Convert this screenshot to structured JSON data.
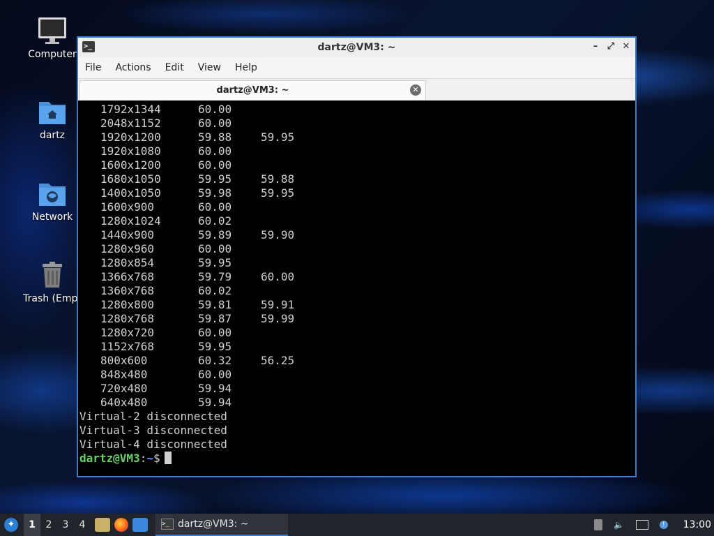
{
  "desktop": {
    "icons": [
      {
        "label": "Computer",
        "icon": "computer-icon"
      },
      {
        "label": "dartz",
        "icon": "home-folder-icon"
      },
      {
        "label": "Network",
        "icon": "network-folder-icon"
      },
      {
        "label": "Trash (Empt",
        "icon": "trash-icon"
      }
    ]
  },
  "window": {
    "title": "dartz@VM3: ~",
    "menu": [
      "File",
      "Actions",
      "Edit",
      "View",
      "Help"
    ],
    "tab_label": "dartz@VM3: ~",
    "controls": {
      "minimize": "–",
      "maximize": "⤢",
      "close": "✕"
    }
  },
  "terminal": {
    "modes": [
      [
        "1792x1344",
        "60.00",
        ""
      ],
      [
        "2048x1152",
        "60.00",
        ""
      ],
      [
        "1920x1200",
        "59.88",
        "59.95"
      ],
      [
        "1920x1080",
        "60.00",
        ""
      ],
      [
        "1600x1200",
        "60.00",
        ""
      ],
      [
        "1680x1050",
        "59.95",
        "59.88"
      ],
      [
        "1400x1050",
        "59.98",
        "59.95"
      ],
      [
        "1600x900",
        "60.00",
        ""
      ],
      [
        "1280x1024",
        "60.02",
        ""
      ],
      [
        "1440x900",
        "59.89",
        "59.90"
      ],
      [
        "1280x960",
        "60.00",
        ""
      ],
      [
        "1280x854",
        "59.95",
        ""
      ],
      [
        "1366x768",
        "59.79",
        "60.00"
      ],
      [
        "1360x768",
        "60.02",
        ""
      ],
      [
        "1280x800",
        "59.81",
        "59.91"
      ],
      [
        "1280x768",
        "59.87",
        "59.99"
      ],
      [
        "1280x720",
        "60.00",
        ""
      ],
      [
        "1152x768",
        "59.95",
        ""
      ],
      [
        "800x600",
        "60.32",
        "56.25"
      ],
      [
        "848x480",
        "60.00",
        ""
      ],
      [
        "720x480",
        "59.94",
        ""
      ],
      [
        "640x480",
        "59.94",
        ""
      ]
    ],
    "status_lines": [
      "Virtual-2 disconnected",
      "Virtual-3 disconnected",
      "Virtual-4 disconnected"
    ],
    "prompt": {
      "user_host": "dartz@VM3",
      "colon": ":",
      "path": "~",
      "symbol": "$"
    }
  },
  "taskbar": {
    "workspaces": [
      "1",
      "2",
      "3",
      "4"
    ],
    "active_workspace": "1",
    "task_label": "dartz@VM3: ~",
    "clock": "13:00"
  },
  "colors": {
    "accent": "#3a7bd5",
    "prompt_user": "#6ad26a",
    "prompt_path": "#6aa0ff"
  }
}
